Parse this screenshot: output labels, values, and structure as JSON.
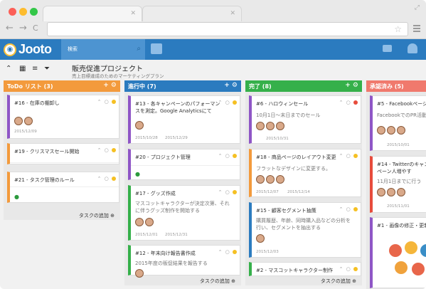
{
  "browser": {
    "back": "←",
    "forward": "→",
    "reload": "C",
    "star": "☆"
  },
  "app": {
    "logo": "Jooto",
    "search_label": "検索"
  },
  "project": {
    "title": "販売促進プロジェクト",
    "subtitle": "売上目標達成のためのマーケティングプラン"
  },
  "lists": [
    {
      "title": "ToDo リスト (3)",
      "color": "#f39a3c",
      "footer": "タスクの追加",
      "cards": [
        {
          "title": "#16 - 在庫の棚卸し",
          "color": "#8f56c6",
          "meta": "2015/12/09"
        },
        {
          "title": "#19 - クリスマスセール開始",
          "color": "#f39a3c"
        },
        {
          "title": "#21 - タスク管理のルール",
          "color": "#f39a3c"
        }
      ]
    },
    {
      "title": "進行中 (7)",
      "color": "#2b7bbf",
      "footer": "タスクの追加",
      "cards": [
        {
          "title": "#13 - 各キャンペーンのパフォーマンスを測定。Google Analyticsにて",
          "color": "#8f56c6",
          "meta": "2015/10/28",
          "meta2": "2015/12/29"
        },
        {
          "title": "#20 - プロジェクト管理",
          "color": "#8f56c6"
        },
        {
          "title": "#17 - グッズ作成",
          "color": "#35b04a",
          "desc": "マスコットキャラクターが決定次第、それに伴うグッズ制作を開始する",
          "meta": "2015/12/01",
          "meta2": "2015/12/31"
        },
        {
          "title": "#12 - 年末向け報告書作成",
          "color": "#35b04a",
          "desc": "2015年度の販促結果を報告する"
        }
      ]
    },
    {
      "title": "完了 (8)",
      "color": "#35b04a",
      "footer": "タスクの追加",
      "cards": [
        {
          "title": "#6 - ハロウィンセール",
          "color": "#8f56c6",
          "desc": "10月1日〜末日までのセール",
          "meta": "2015/10/31"
        },
        {
          "title": "#18 - 商品ページのレイアウト変更",
          "color": "#f39a3c",
          "desc": "フラットなデザインに変更する。",
          "meta": "2015/12/07",
          "meta2": "2015/12/14"
        },
        {
          "title": "#15 - 顧客セグメント抽策",
          "color": "#2b7bbf",
          "desc": "購買履歴、年齢、同時購入品などの分析を行い、セグメントを抽出する",
          "meta": "2015/12/03"
        },
        {
          "title": "#2 - マスコットキャラクター制作",
          "color": "#35b04a"
        }
      ]
    },
    {
      "title": "承認済み (5)",
      "color": "#f0796d",
      "cards": [
        {
          "title": "#5 - Facebookページ作",
          "color": "#8f56c6",
          "desc": "FacebookでのPR活動を",
          "meta": "2015/10/01"
        },
        {
          "title": "#14 - Twitterのキャンペーン人増やす",
          "color": "#e74c3c",
          "desc": "11月1日までに行う",
          "meta": "2015/11/01"
        },
        {
          "title": "#1 - 画像の修正・更新",
          "color": "#8f56c6"
        }
      ]
    }
  ]
}
